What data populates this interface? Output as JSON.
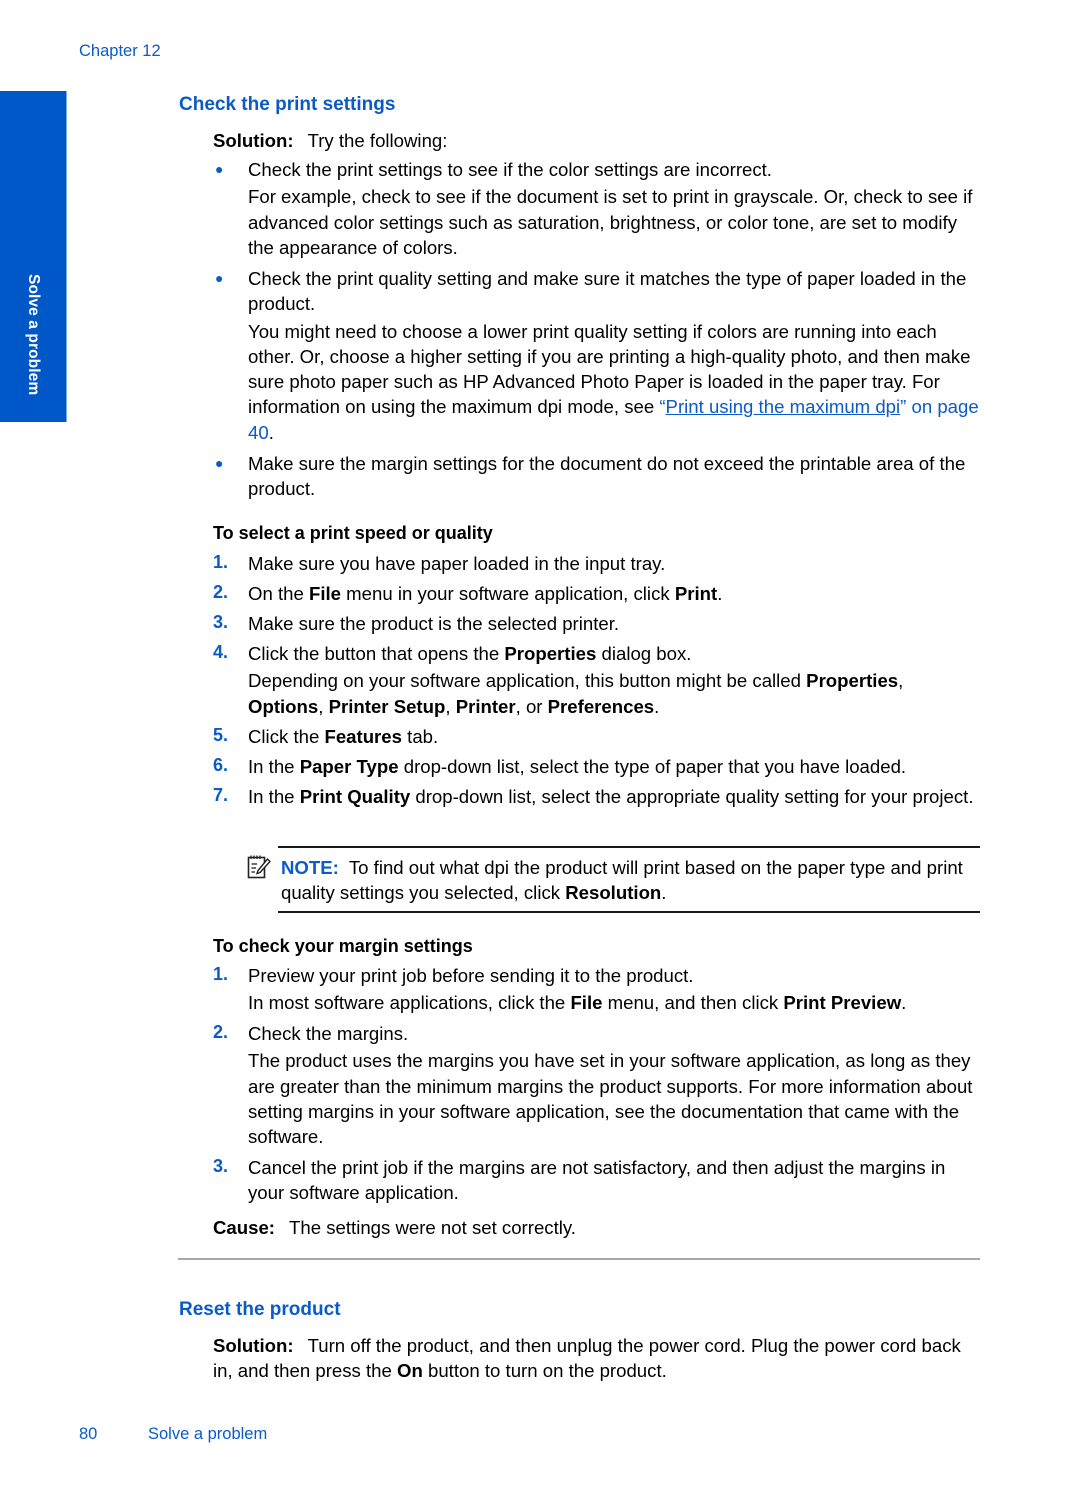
{
  "header": {
    "chapter": "Chapter 12"
  },
  "side_tab": {
    "label": "Solve a problem",
    "color": "#0058c8"
  },
  "sections": {
    "check_print_settings": {
      "title": "Check the print settings",
      "solution_label": "Solution:",
      "solution_text": "Try the following:",
      "bullets": [
        {
          "text": "Check the print settings to see if the color settings are incorrect.",
          "detail": "For example, check to see if the document is set to print in grayscale. Or, check to see if advanced color settings such as saturation, brightness, or color tone, are set to modify the appearance of colors."
        },
        {
          "text": "Check the print quality setting and make sure it matches the type of paper loaded in the product.",
          "detail_before": "You might need to choose a lower print quality setting if colors are running into each other. Or, choose a higher setting if you are printing a high-quality photo, and then make sure photo paper such as HP Advanced Photo Paper is loaded in the paper tray. For information on using the maximum dpi mode, see ",
          "link_open_quote": "“",
          "link_text": "Print using the maximum dpi",
          "link_close": "” on page 40",
          "detail_after": "."
        },
        {
          "text": "Make sure the margin settings for the document do not exceed the printable area of the product."
        }
      ]
    },
    "select_speed_quality": {
      "title": "To select a print speed or quality",
      "steps": [
        {
          "num": "1.",
          "parts": [
            {
              "t": "Make sure you have paper loaded in the input tray."
            }
          ]
        },
        {
          "num": "2.",
          "parts": [
            {
              "t": "On the "
            },
            {
              "b": "File"
            },
            {
              "t": " menu in your software application, click "
            },
            {
              "b": "Print"
            },
            {
              "t": "."
            }
          ]
        },
        {
          "num": "3.",
          "parts": [
            {
              "t": "Make sure the product is the selected printer."
            }
          ]
        },
        {
          "num": "4.",
          "parts": [
            {
              "t": "Click the button that opens the "
            },
            {
              "b": "Properties"
            },
            {
              "t": " dialog box."
            }
          ],
          "detail": [
            {
              "t": "Depending on your software application, this button might be called "
            },
            {
              "b": "Properties"
            },
            {
              "t": ", "
            },
            {
              "b": "Options"
            },
            {
              "t": ", "
            },
            {
              "b": "Printer Setup"
            },
            {
              "t": ", "
            },
            {
              "b": "Printer"
            },
            {
              "t": ", or "
            },
            {
              "b": "Preferences"
            },
            {
              "t": "."
            }
          ]
        },
        {
          "num": "5.",
          "parts": [
            {
              "t": "Click the "
            },
            {
              "b": "Features"
            },
            {
              "t": " tab."
            }
          ]
        },
        {
          "num": "6.",
          "parts": [
            {
              "t": "In the "
            },
            {
              "b": "Paper Type"
            },
            {
              "t": " drop-down list, select the type of paper that you have loaded."
            }
          ]
        },
        {
          "num": "7.",
          "parts": [
            {
              "t": "In the "
            },
            {
              "b": "Print Quality"
            },
            {
              "t": " drop-down list, select the appropriate quality setting for your project."
            }
          ]
        }
      ],
      "note": {
        "icon": "note-pencil-icon",
        "label": "NOTE:",
        "text": "To find out what dpi the product will print based on the paper type and print quality settings you selected, click ",
        "bold": "Resolution",
        "end": "."
      }
    },
    "check_margins": {
      "title": "To check your margin settings",
      "steps": [
        {
          "num": "1.",
          "parts": [
            {
              "t": "Preview your print job before sending it to the product."
            }
          ],
          "detail": [
            {
              "t": "In most software applications, click the "
            },
            {
              "b": "File"
            },
            {
              "t": " menu, and then click "
            },
            {
              "b": "Print Preview"
            },
            {
              "t": "."
            }
          ]
        },
        {
          "num": "2.",
          "parts": [
            {
              "t": "Check the margins."
            }
          ],
          "detail": [
            {
              "t": "The product uses the margins you have set in your software application, as long as they are greater than the minimum margins the product supports. For more information about setting margins in your software application, see the documentation that came with the software."
            }
          ]
        },
        {
          "num": "3.",
          "parts": [
            {
              "t": "Cancel the print job if the margins are not satisfactory, and then adjust the margins in your software application."
            }
          ]
        }
      ],
      "cause_label": "Cause:",
      "cause_text": "The settings were not set correctly."
    },
    "reset_product": {
      "title": "Reset the product",
      "solution_label": "Solution:",
      "parts": [
        {
          "t": "Turn off the product, and then unplug the power cord. Plug the power cord back in, and then press the "
        },
        {
          "b": "On"
        },
        {
          "t": " button to turn on the product."
        }
      ]
    }
  },
  "footer": {
    "page_number": "80",
    "section_title": "Solve a problem"
  }
}
